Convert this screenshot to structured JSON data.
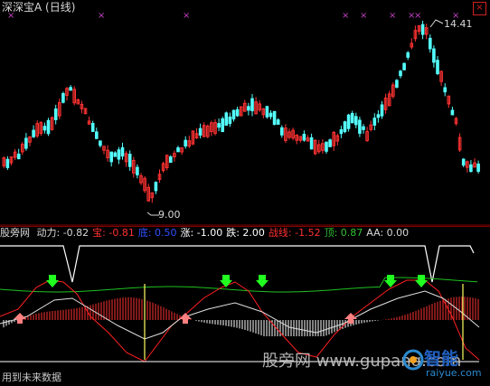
{
  "main": {
    "title": "深深宝A (日线)",
    "close_glyph": "×",
    "high_label": "14.41",
    "low_label": "9.00"
  },
  "indicator": {
    "name": "股旁网",
    "items": [
      {
        "label": "动力:",
        "value": "-0.82",
        "color": "#d8d8d8"
      },
      {
        "label": "宝:",
        "value": "-0.81",
        "color": "#ff3030"
      },
      {
        "label": "底:",
        "value": "0.50",
        "color": "#3050ff"
      },
      {
        "label": "涨:",
        "value": "-1.00",
        "color": "#ffffff"
      },
      {
        "label": "跌:",
        "value": "2.00",
        "color": "#ffffff"
      },
      {
        "label": "战线:",
        "value": "-1.52",
        "color": "#ff3030"
      },
      {
        "label": "顶:",
        "value": "0.87",
        "color": "#30c030"
      },
      {
        "label": "AA:",
        "value": "0.00",
        "color": "#d8d8d8"
      }
    ]
  },
  "footer": "用到未来数据",
  "watermark": "股旁网 www.gupang.com",
  "logo": {
    "big": "智能",
    "small": "raiyue.com"
  },
  "colors": {
    "up": "#ff3232",
    "down": "#54ffff",
    "marker": "#c040c0",
    "grid": "#800000",
    "green": "#20ff20",
    "pink": "#ff8080"
  },
  "chart_data": {
    "type": "candlestick",
    "high": 14.41,
    "low": 9.0
  }
}
